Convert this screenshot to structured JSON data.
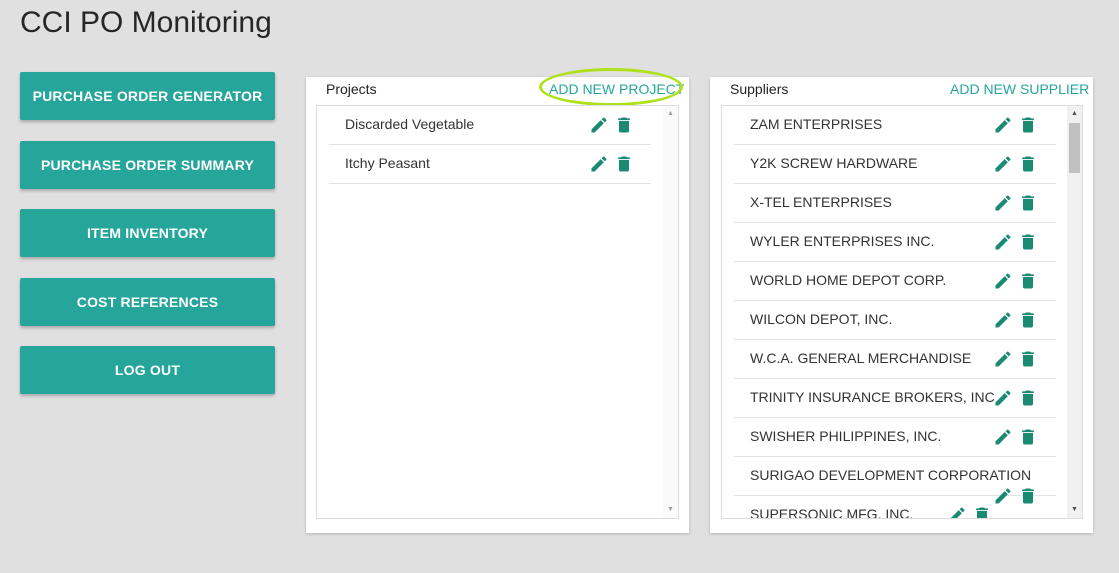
{
  "app": {
    "title": "CCI PO Monitoring"
  },
  "nav": {
    "items": [
      {
        "label": "PURCHASE ORDER GENERATOR"
      },
      {
        "label": "PURCHASE ORDER SUMMARY"
      },
      {
        "label": "ITEM INVENTORY"
      },
      {
        "label": "COST REFERENCES"
      },
      {
        "label": "LOG OUT"
      }
    ]
  },
  "projects": {
    "title": "Projects",
    "add_label": "ADD NEW PROJECT",
    "items": [
      {
        "label": "Discarded Vegetable"
      },
      {
        "label": "Itchy Peasant"
      }
    ]
  },
  "suppliers": {
    "title": "Suppliers",
    "add_label": "ADD NEW SUPPLIER",
    "items": [
      {
        "label": "ZAM ENTERPRISES"
      },
      {
        "label": "Y2K SCREW HARDWARE"
      },
      {
        "label": "X-TEL ENTERPRISES"
      },
      {
        "label": "WYLER ENTERPRISES INC."
      },
      {
        "label": "WORLD HOME DEPOT CORP."
      },
      {
        "label": "WILCON DEPOT, INC."
      },
      {
        "label": "W.C.A. GENERAL MERCHANDISE"
      },
      {
        "label": "TRINITY INSURANCE BROKERS, INC"
      },
      {
        "label": "SWISHER PHILIPPINES, INC."
      },
      {
        "label": "SURIGAO DEVELOPMENT CORPORATION"
      },
      {
        "label": "SUPERSONIC MFG. INC."
      }
    ]
  },
  "icons": {
    "edit": "pencil-icon",
    "delete": "trash-icon"
  },
  "colors": {
    "accent": "#26a69a",
    "icon": "#1a8a73",
    "highlight": "#aee11a",
    "background": "#e0e0e0"
  }
}
